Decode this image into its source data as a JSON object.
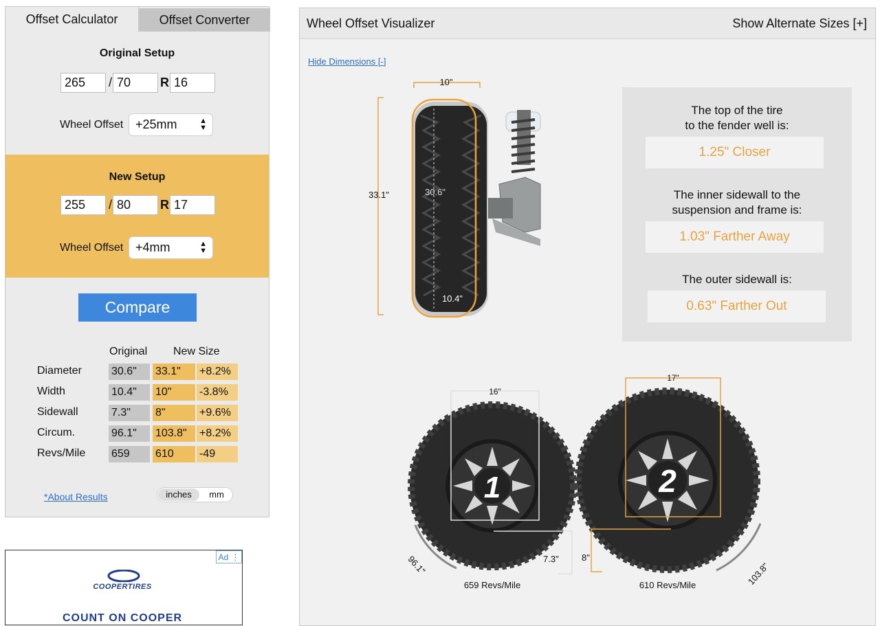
{
  "tabs": {
    "calculator": "Offset Calculator",
    "converter": "Offset Converter"
  },
  "original_setup": {
    "title": "Original Setup",
    "width": "265",
    "aspect": "70",
    "rim": "16",
    "separator": "/",
    "r_label": "R",
    "offset_label": "Wheel Offset",
    "offset_value": "+25mm"
  },
  "new_setup": {
    "title": "New Setup",
    "width": "255",
    "aspect": "80",
    "rim": "17",
    "separator": "/",
    "r_label": "R",
    "offset_label": "Wheel Offset",
    "offset_value": "+4mm"
  },
  "compare_label": "Compare",
  "results": {
    "col_original": "Original",
    "col_new": "New Size",
    "rows": [
      {
        "label": "Diameter",
        "original": "30.6\"",
        "new": "33.1\"",
        "diff": "+8.2%"
      },
      {
        "label": "Width",
        "original": "10.4\"",
        "new": "10\"",
        "diff": "-3.8%"
      },
      {
        "label": "Sidewall",
        "original": "7.3\"",
        "new": "8\"",
        "diff": "+9.6%"
      },
      {
        "label": "Circum.",
        "original": "96.1\"",
        "new": "103.8\"",
        "diff": "+8.2%"
      },
      {
        "label": "Revs/Mile",
        "original": "659",
        "new": "610",
        "diff": "-49"
      }
    ]
  },
  "about_link": "*About Results",
  "units": {
    "inches": "inches",
    "mm": "mm"
  },
  "ad": {
    "badge": "Ad",
    "brand": "COOPERTIRES",
    "slogan": "COUNT ON COOPER"
  },
  "visualizer": {
    "title": "Wheel Offset Visualizer",
    "alt_sizes": "Show Alternate Sizes [+]",
    "hide_dimensions": "Hide Dimensions [-]",
    "side_view": {
      "new_width": "10\"",
      "new_diameter": "33.1\"",
      "orig_diameter": "30.6\"",
      "orig_width": "10.4\""
    },
    "info": [
      {
        "question": [
          "The top of the tire",
          "to the fender well is:"
        ],
        "answer": "1.25\" Closer"
      },
      {
        "question": [
          "The inner sidewall to the",
          "suspension and frame is:"
        ],
        "answer": "1.03\" Farther Away"
      },
      {
        "question": [
          "The outer sidewall is:"
        ],
        "answer": "0.63\" Farther Out"
      }
    ],
    "tire1": {
      "number": "1",
      "rim": "16\"",
      "sidewall": "7.3\"",
      "circumference": "96.1\"",
      "revs": "659 Revs/Mile"
    },
    "tire2": {
      "number": "2",
      "rim": "17\"",
      "sidewall": "8\"",
      "circumference": "103.8\"",
      "revs": "610 Revs/Mile"
    }
  },
  "colors": {
    "orange": "#eebe5f",
    "accent": "#e6a341",
    "blue": "#3d88dc",
    "link": "#2f6fc6",
    "gray": "#c6c6c6"
  }
}
